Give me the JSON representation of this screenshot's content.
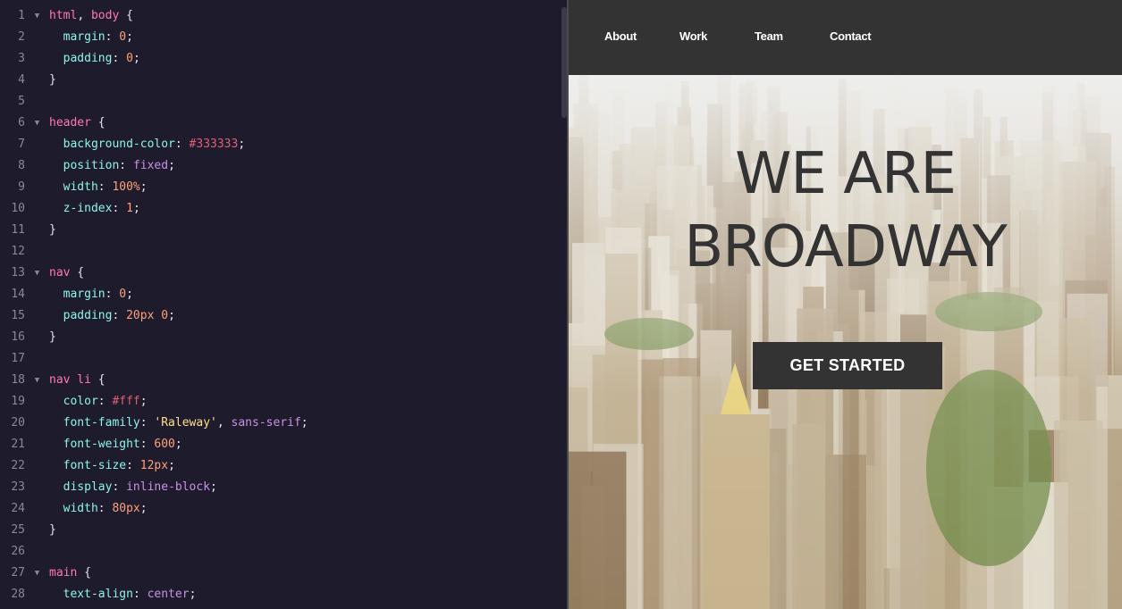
{
  "editor": {
    "lines": [
      {
        "n": "1",
        "fold": true,
        "tokens": [
          [
            "sel",
            "html"
          ],
          [
            "punc",
            ", "
          ],
          [
            "sel",
            "body"
          ],
          [
            "punc",
            " {"
          ]
        ]
      },
      {
        "n": "2",
        "fold": false,
        "tokens": [
          [
            "punc",
            "  "
          ],
          [
            "prop",
            "margin"
          ],
          [
            "punc",
            ": "
          ],
          [
            "num",
            "0"
          ],
          [
            "punc",
            ";"
          ]
        ]
      },
      {
        "n": "3",
        "fold": false,
        "tokens": [
          [
            "punc",
            "  "
          ],
          [
            "prop",
            "padding"
          ],
          [
            "punc",
            ": "
          ],
          [
            "num",
            "0"
          ],
          [
            "punc",
            ";"
          ]
        ]
      },
      {
        "n": "4",
        "fold": false,
        "tokens": [
          [
            "punc",
            "}"
          ]
        ]
      },
      {
        "n": "5",
        "fold": false,
        "tokens": []
      },
      {
        "n": "6",
        "fold": true,
        "tokens": [
          [
            "sel",
            "header"
          ],
          [
            "punc",
            " {"
          ]
        ]
      },
      {
        "n": "7",
        "fold": false,
        "tokens": [
          [
            "punc",
            "  "
          ],
          [
            "prop",
            "background-color"
          ],
          [
            "punc",
            ": "
          ],
          [
            "hex",
            "#333333"
          ],
          [
            "punc",
            ";"
          ]
        ]
      },
      {
        "n": "8",
        "fold": false,
        "tokens": [
          [
            "punc",
            "  "
          ],
          [
            "prop",
            "position"
          ],
          [
            "punc",
            ": "
          ],
          [
            "kw",
            "fixed"
          ],
          [
            "punc",
            ";"
          ]
        ]
      },
      {
        "n": "9",
        "fold": false,
        "tokens": [
          [
            "punc",
            "  "
          ],
          [
            "prop",
            "width"
          ],
          [
            "punc",
            ": "
          ],
          [
            "num",
            "100%"
          ],
          [
            "punc",
            ";"
          ]
        ]
      },
      {
        "n": "10",
        "fold": false,
        "tokens": [
          [
            "punc",
            "  "
          ],
          [
            "prop",
            "z-index"
          ],
          [
            "punc",
            ": "
          ],
          [
            "num",
            "1"
          ],
          [
            "punc",
            ";"
          ]
        ]
      },
      {
        "n": "11",
        "fold": false,
        "tokens": [
          [
            "punc",
            "}"
          ]
        ]
      },
      {
        "n": "12",
        "fold": false,
        "tokens": []
      },
      {
        "n": "13",
        "fold": true,
        "tokens": [
          [
            "sel",
            "nav"
          ],
          [
            "punc",
            " {"
          ]
        ]
      },
      {
        "n": "14",
        "fold": false,
        "tokens": [
          [
            "punc",
            "  "
          ],
          [
            "prop",
            "margin"
          ],
          [
            "punc",
            ": "
          ],
          [
            "num",
            "0"
          ],
          [
            "punc",
            ";"
          ]
        ]
      },
      {
        "n": "15",
        "fold": false,
        "tokens": [
          [
            "punc",
            "  "
          ],
          [
            "prop",
            "padding"
          ],
          [
            "punc",
            ": "
          ],
          [
            "num",
            "20px 0"
          ],
          [
            "punc",
            ";"
          ]
        ]
      },
      {
        "n": "16",
        "fold": false,
        "tokens": [
          [
            "punc",
            "}"
          ]
        ]
      },
      {
        "n": "17",
        "fold": false,
        "tokens": []
      },
      {
        "n": "18",
        "fold": true,
        "tokens": [
          [
            "sel",
            "nav li"
          ],
          [
            "punc",
            " {"
          ]
        ]
      },
      {
        "n": "19",
        "fold": false,
        "tokens": [
          [
            "punc",
            "  "
          ],
          [
            "prop",
            "color"
          ],
          [
            "punc",
            ": "
          ],
          [
            "hex",
            "#fff"
          ],
          [
            "punc",
            ";"
          ]
        ]
      },
      {
        "n": "20",
        "fold": false,
        "tokens": [
          [
            "punc",
            "  "
          ],
          [
            "prop",
            "font-family"
          ],
          [
            "punc",
            ": "
          ],
          [
            "str",
            "'Raleway'"
          ],
          [
            "punc",
            ", "
          ],
          [
            "kw",
            "sans-serif"
          ],
          [
            "punc",
            ";"
          ]
        ]
      },
      {
        "n": "21",
        "fold": false,
        "tokens": [
          [
            "punc",
            "  "
          ],
          [
            "prop",
            "font-weight"
          ],
          [
            "punc",
            ": "
          ],
          [
            "num",
            "600"
          ],
          [
            "punc",
            ";"
          ]
        ]
      },
      {
        "n": "22",
        "fold": false,
        "tokens": [
          [
            "punc",
            "  "
          ],
          [
            "prop",
            "font-size"
          ],
          [
            "punc",
            ": "
          ],
          [
            "num",
            "12px"
          ],
          [
            "punc",
            ";"
          ]
        ]
      },
      {
        "n": "23",
        "fold": false,
        "tokens": [
          [
            "punc",
            "  "
          ],
          [
            "prop",
            "display"
          ],
          [
            "punc",
            ": "
          ],
          [
            "kw",
            "inline-block"
          ],
          [
            "punc",
            ";"
          ]
        ]
      },
      {
        "n": "24",
        "fold": false,
        "tokens": [
          [
            "punc",
            "  "
          ],
          [
            "prop",
            "width"
          ],
          [
            "punc",
            ": "
          ],
          [
            "num",
            "80px"
          ],
          [
            "punc",
            ";"
          ]
        ]
      },
      {
        "n": "25",
        "fold": false,
        "tokens": [
          [
            "punc",
            "}"
          ]
        ]
      },
      {
        "n": "26",
        "fold": false,
        "tokens": []
      },
      {
        "n": "27",
        "fold": true,
        "tokens": [
          [
            "sel",
            "main"
          ],
          [
            "punc",
            " {"
          ]
        ]
      },
      {
        "n": "28",
        "fold": false,
        "tokens": [
          [
            "punc",
            "  "
          ],
          [
            "prop",
            "text-align"
          ],
          [
            "punc",
            ": "
          ],
          [
            "kw",
            "center"
          ],
          [
            "punc",
            ";"
          ]
        ]
      }
    ],
    "fold_glyph": "▼"
  },
  "preview": {
    "nav": [
      "About",
      "Work",
      "Team",
      "Contact"
    ],
    "hero": {
      "title_line1": "WE ARE",
      "title_line2": "BROADWAY",
      "cta": "GET STARTED"
    }
  },
  "colors": {
    "editor_bg": "#1e1b2c",
    "header_bg": "#333333",
    "selector": "#ff7ab2",
    "property": "#8ef4ea",
    "number": "#ffa07a",
    "keyword": "#c891e8",
    "string": "#ffe08a"
  }
}
